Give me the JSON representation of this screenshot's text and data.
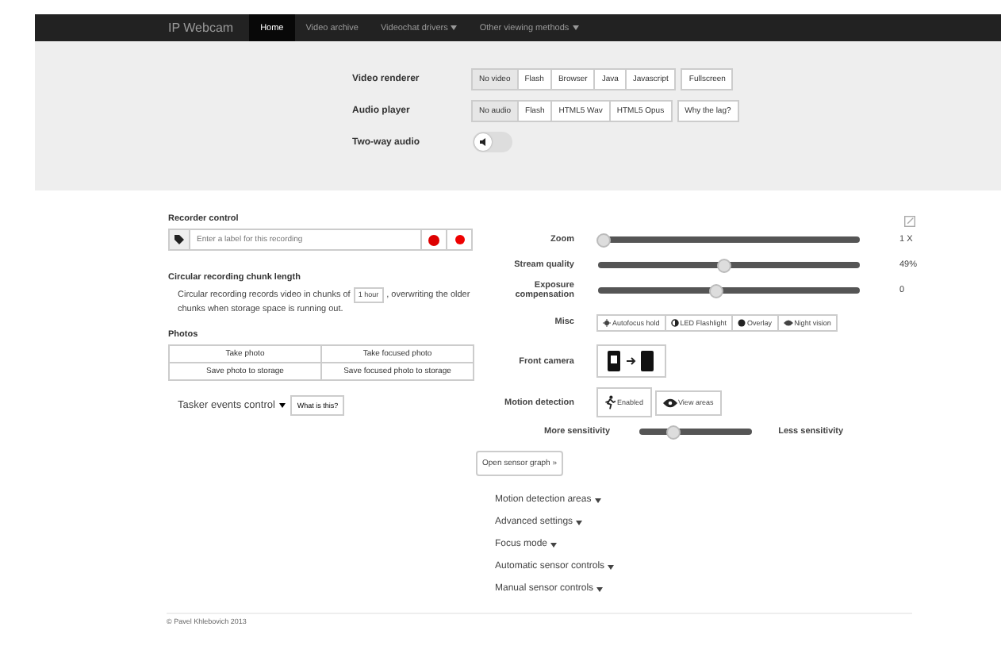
{
  "navbar": {
    "brand": "IP Webcam",
    "items": [
      {
        "label": "Home",
        "selected": true,
        "dropdown": false
      },
      {
        "label": "Video archive",
        "selected": false,
        "dropdown": false
      },
      {
        "label": "Videochat drivers",
        "selected": false,
        "dropdown": true
      },
      {
        "label": "Other viewing methods",
        "selected": false,
        "dropdown": true
      }
    ]
  },
  "players": [
    {
      "label": "Video renderer",
      "options": [
        {
          "label": "No video",
          "selected": true
        },
        {
          "label": "Flash",
          "selected": false
        },
        {
          "label": "Browser",
          "selected": false
        },
        {
          "label": "Java",
          "selected": false
        },
        {
          "label": "Javascript",
          "selected": false
        }
      ],
      "extra": "Fullscreen"
    },
    {
      "label": "Audio player",
      "options": [
        {
          "label": "No audio",
          "selected": true
        },
        {
          "label": "Flash",
          "selected": false
        },
        {
          "label": "HTML5 Wav",
          "selected": false
        },
        {
          "label": "HTML5 Opus",
          "selected": false
        }
      ],
      "extra": "Why the lag?"
    }
  ],
  "two_way_audio": {
    "label": "Two-way audio",
    "on": false
  },
  "recorder": {
    "title": "Recorder control",
    "placeholder": "Enter a label for this recording"
  },
  "circular": {
    "title": "Circular recording chunk length",
    "text_before": "Circular recording records video in chunks of",
    "select": "1 hour",
    "text_after": ", overwriting the older chunks when storage space is running out."
  },
  "photos": {
    "title": "Photos",
    "buttons": [
      "Take photo",
      "Take focused photo",
      "Save photo to storage",
      "Save focused photo to storage"
    ]
  },
  "tasker": {
    "label": "Tasker events control",
    "help": "What is this?"
  },
  "sliders": [
    {
      "label": "Zoom",
      "level": 0.02,
      "reading": "1 X"
    },
    {
      "label": "Stream quality",
      "level": 0.48,
      "reading": "49%"
    },
    {
      "label": "Exposure compensation",
      "level": 0.45,
      "reading": "0"
    }
  ],
  "misc": {
    "label": "Misc",
    "buttons": [
      "Autofocus hold",
      "LED Flashlight",
      "Overlay",
      "Night vision"
    ]
  },
  "front_camera": {
    "label": "Front camera"
  },
  "motion": {
    "label": "Motion detection",
    "buttons": [
      "Enabled",
      "View areas"
    ]
  },
  "sensitivity": {
    "left": "More sensitivity",
    "right": "Less sensitivity",
    "level": 0.3
  },
  "sensor_graph": "Open sensor graph »",
  "sections": [
    "Motion detection areas",
    "Advanced settings",
    "Focus mode",
    "Automatic sensor controls",
    "Manual sensor controls"
  ],
  "footer": "© Pavel Khlebovich 2013"
}
